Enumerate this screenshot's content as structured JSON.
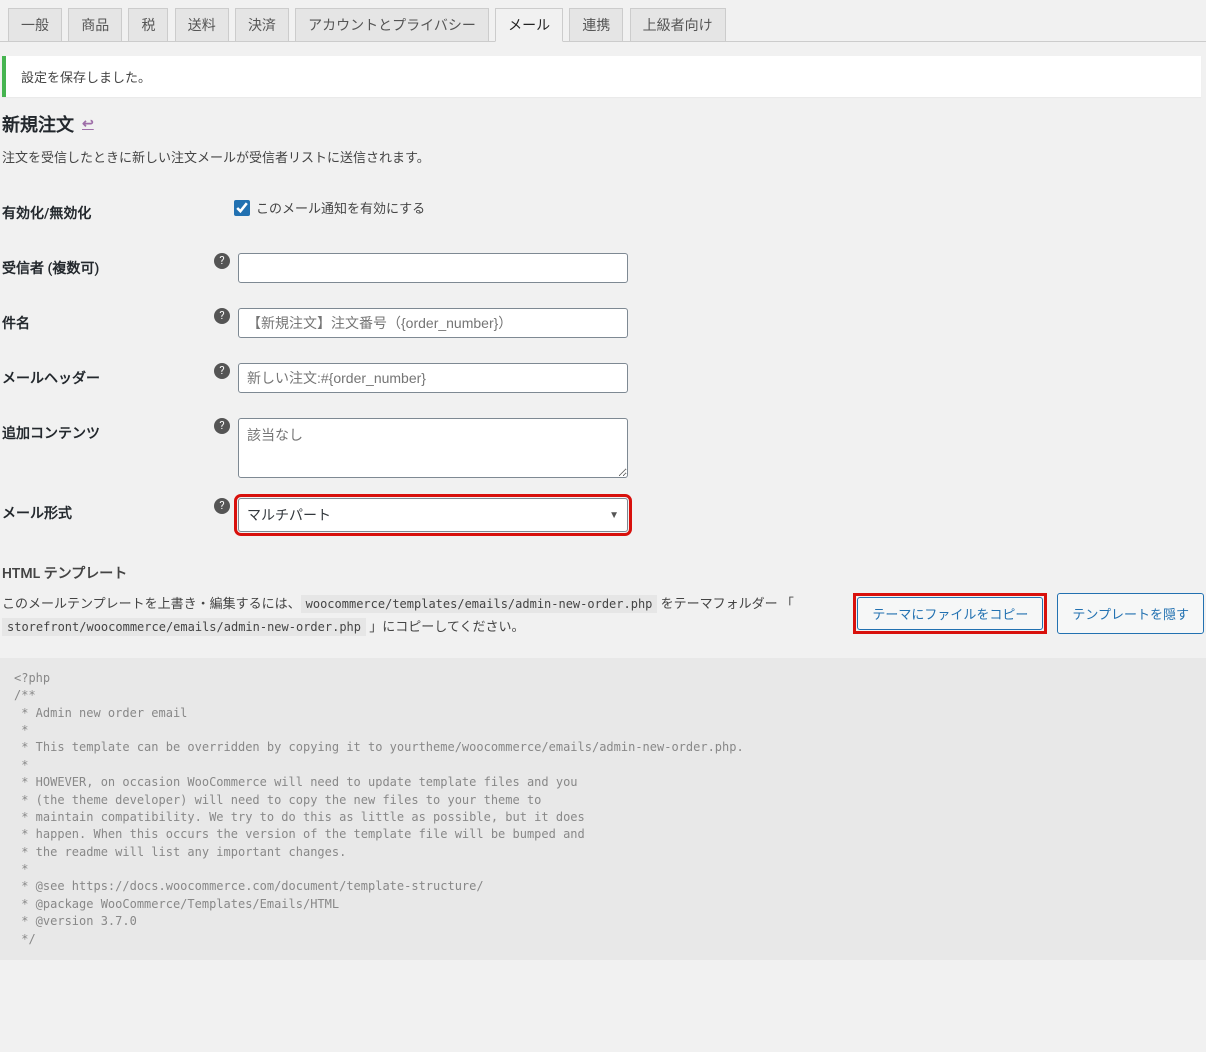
{
  "tabs": {
    "items": [
      {
        "label": "一般",
        "active": false
      },
      {
        "label": "商品",
        "active": false
      },
      {
        "label": "税",
        "active": false
      },
      {
        "label": "送料",
        "active": false
      },
      {
        "label": "決済",
        "active": false
      },
      {
        "label": "アカウントとプライバシー",
        "active": false
      },
      {
        "label": "メール",
        "active": true
      },
      {
        "label": "連携",
        "active": false
      },
      {
        "label": "上級者向け",
        "active": false
      }
    ]
  },
  "notice": {
    "message": "設定を保存しました。"
  },
  "heading": {
    "title": "新規注文",
    "back": "↩"
  },
  "description": "注文を受信したときに新しい注文メールが受信者リストに送信されます。",
  "fields": {
    "enable": {
      "label": "有効化/無効化",
      "checkbox_label": "このメール通知を有効にする",
      "checked": true
    },
    "recipients": {
      "label": "受信者 (複数可)",
      "value": ""
    },
    "subject": {
      "label": "件名",
      "placeholder": "【新規注文】注文番号（{order_number}）",
      "value": ""
    },
    "heading": {
      "label": "メールヘッダー",
      "placeholder": "新しい注文:#{order_number}",
      "value": ""
    },
    "additional": {
      "label": "追加コンテンツ",
      "placeholder": "該当なし",
      "value": ""
    },
    "email_type": {
      "label": "メール形式",
      "selected": "マルチパート"
    }
  },
  "template": {
    "title": "HTML テンプレート",
    "desc_pre": "このメールテンプレートを上書き・編集するには、",
    "path1": "woocommerce/templates/emails/admin-new-order.php",
    "desc_mid": " をテーマフォルダー 「 ",
    "path2": "storefront/woocommerce/emails/admin-new-order.php",
    "desc_post": " 」にコピーしてください。",
    "btn_copy": "テーマにファイルをコピー",
    "btn_hide": "テンプレートを隠す"
  },
  "code_preview": "<?php\n/**\n * Admin new order email\n *\n * This template can be overridden by copying it to yourtheme/woocommerce/emails/admin-new-order.php.\n *\n * HOWEVER, on occasion WooCommerce will need to update template files and you\n * (the theme developer) will need to copy the new files to your theme to\n * maintain compatibility. We try to do this as little as possible, but it does\n * happen. When this occurs the version of the template file will be bumped and\n * the readme will list any important changes.\n *\n * @see https://docs.woocommerce.com/document/template-structure/\n * @package WooCommerce/Templates/Emails/HTML\n * @version 3.7.0\n */"
}
